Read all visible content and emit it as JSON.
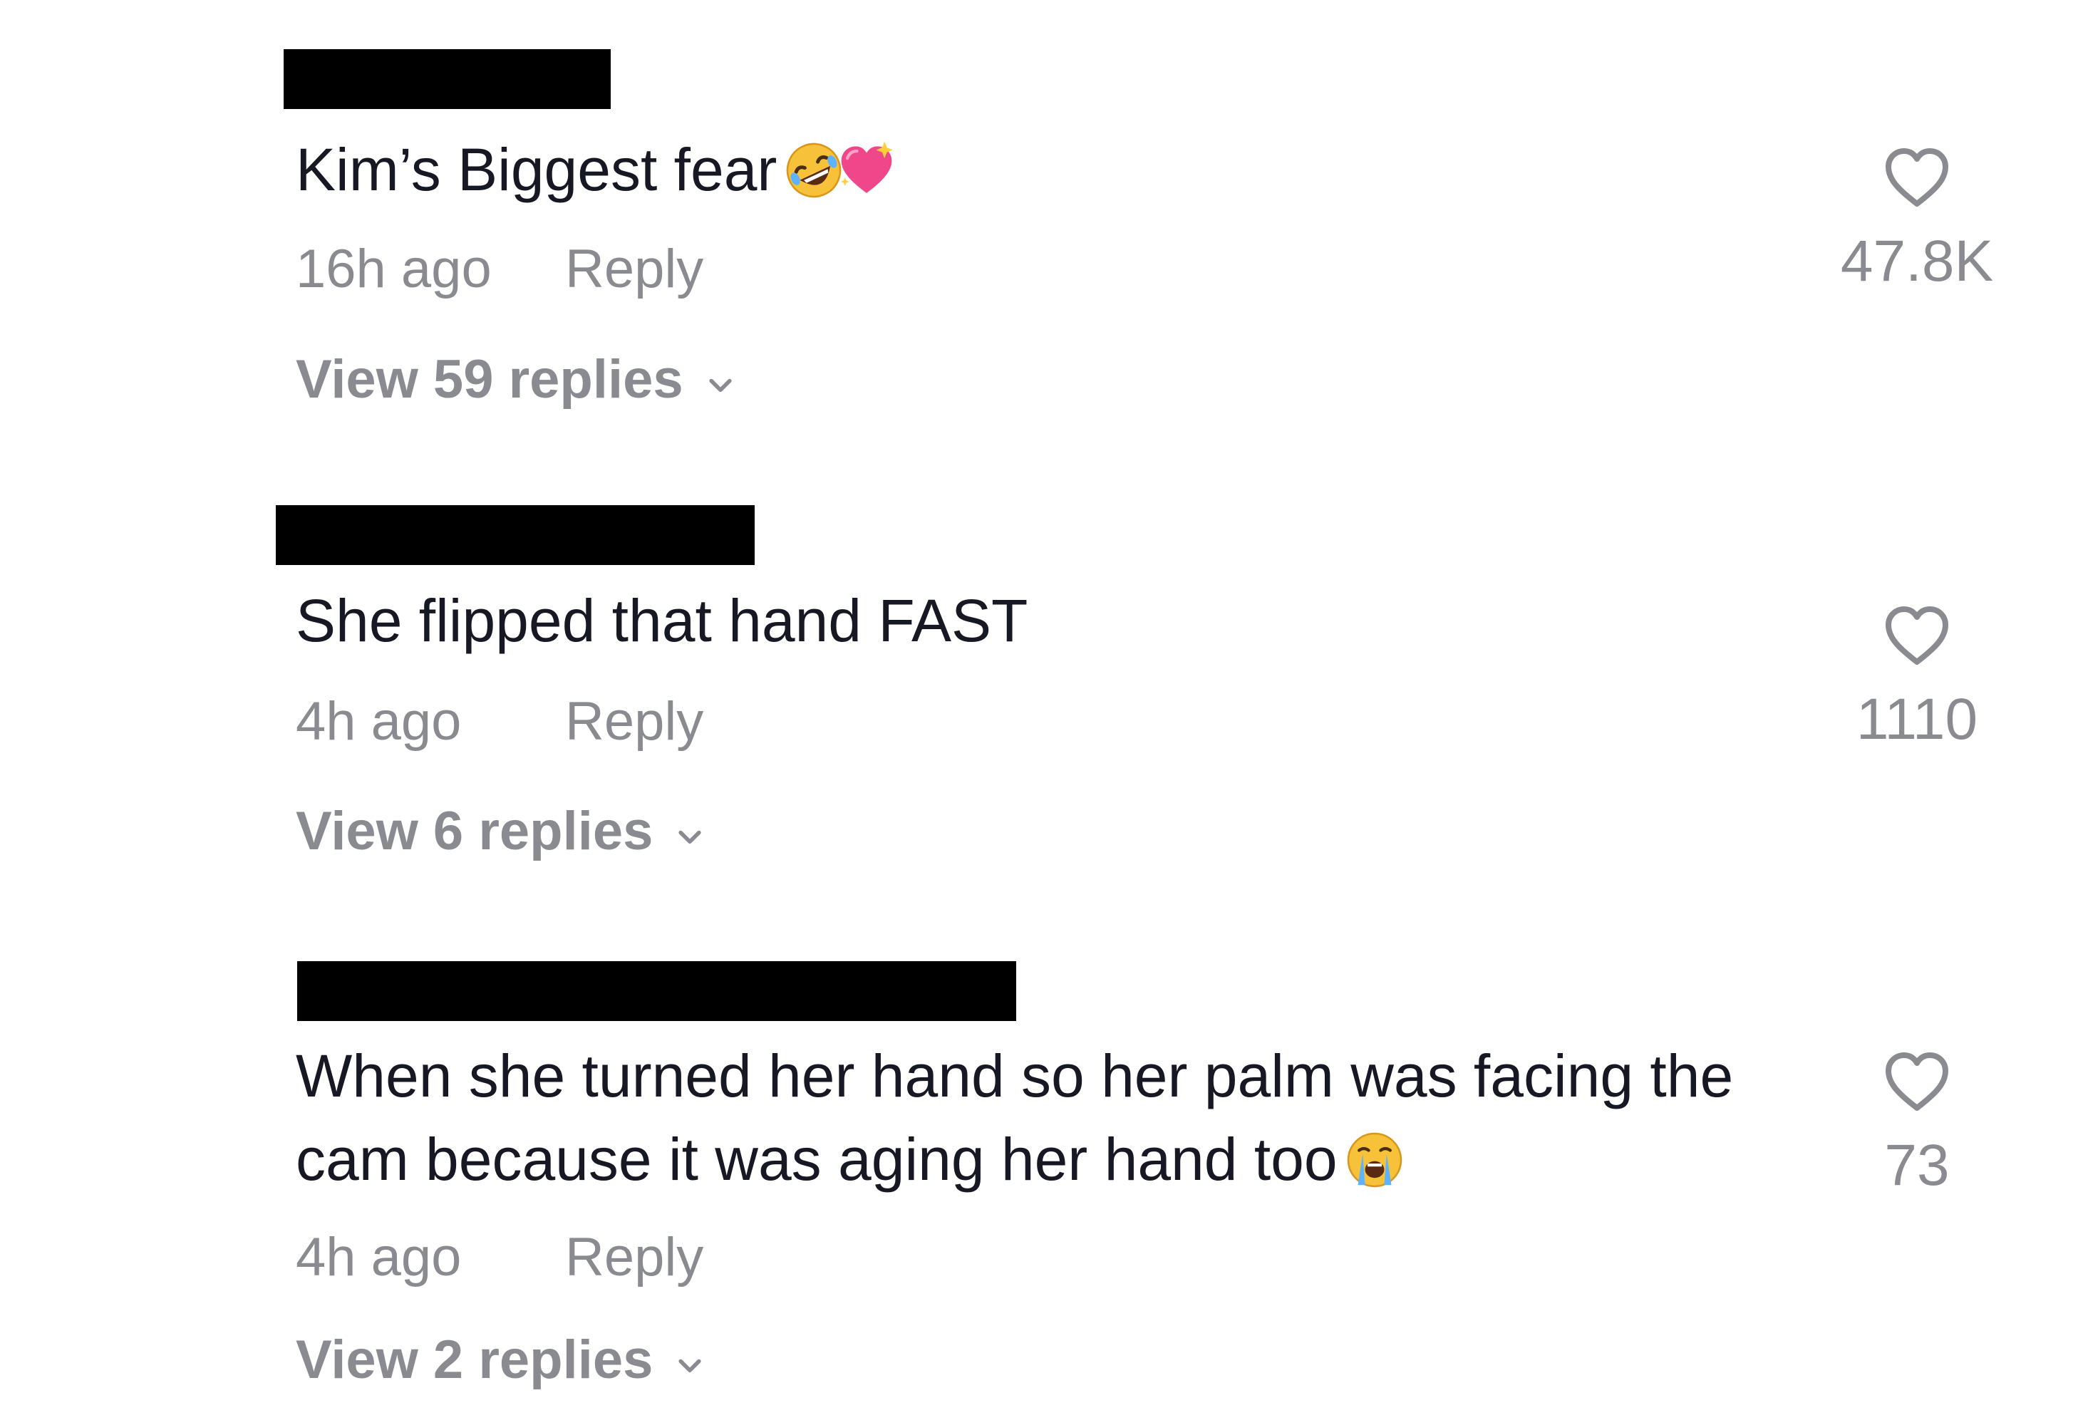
{
  "comments": [
    {
      "text": "Kim’s Biggest fear",
      "emojis": [
        "rolling-on-floor-laughing-emoji",
        "sparkling-heart-emoji"
      ],
      "time": "16h ago",
      "reply_label": "Reply",
      "view_replies": "View 59 replies",
      "likes": "47.8K"
    },
    {
      "text": "She flipped that hand FAST",
      "emojis": [],
      "time": "4h ago",
      "reply_label": "Reply",
      "view_replies": "View 6 replies",
      "likes": "1110"
    },
    {
      "text": "When she turned her hand so her palm was facing the cam because it was aging her hand too",
      "emojis": [
        "loudly-crying-face-emoji"
      ],
      "time": "4h ago",
      "reply_label": "Reply",
      "view_replies": "View 2 replies",
      "likes": "73"
    }
  ],
  "colors": {
    "text": "#161823",
    "secondary": "#8a8b91",
    "redaction": "#000000"
  }
}
